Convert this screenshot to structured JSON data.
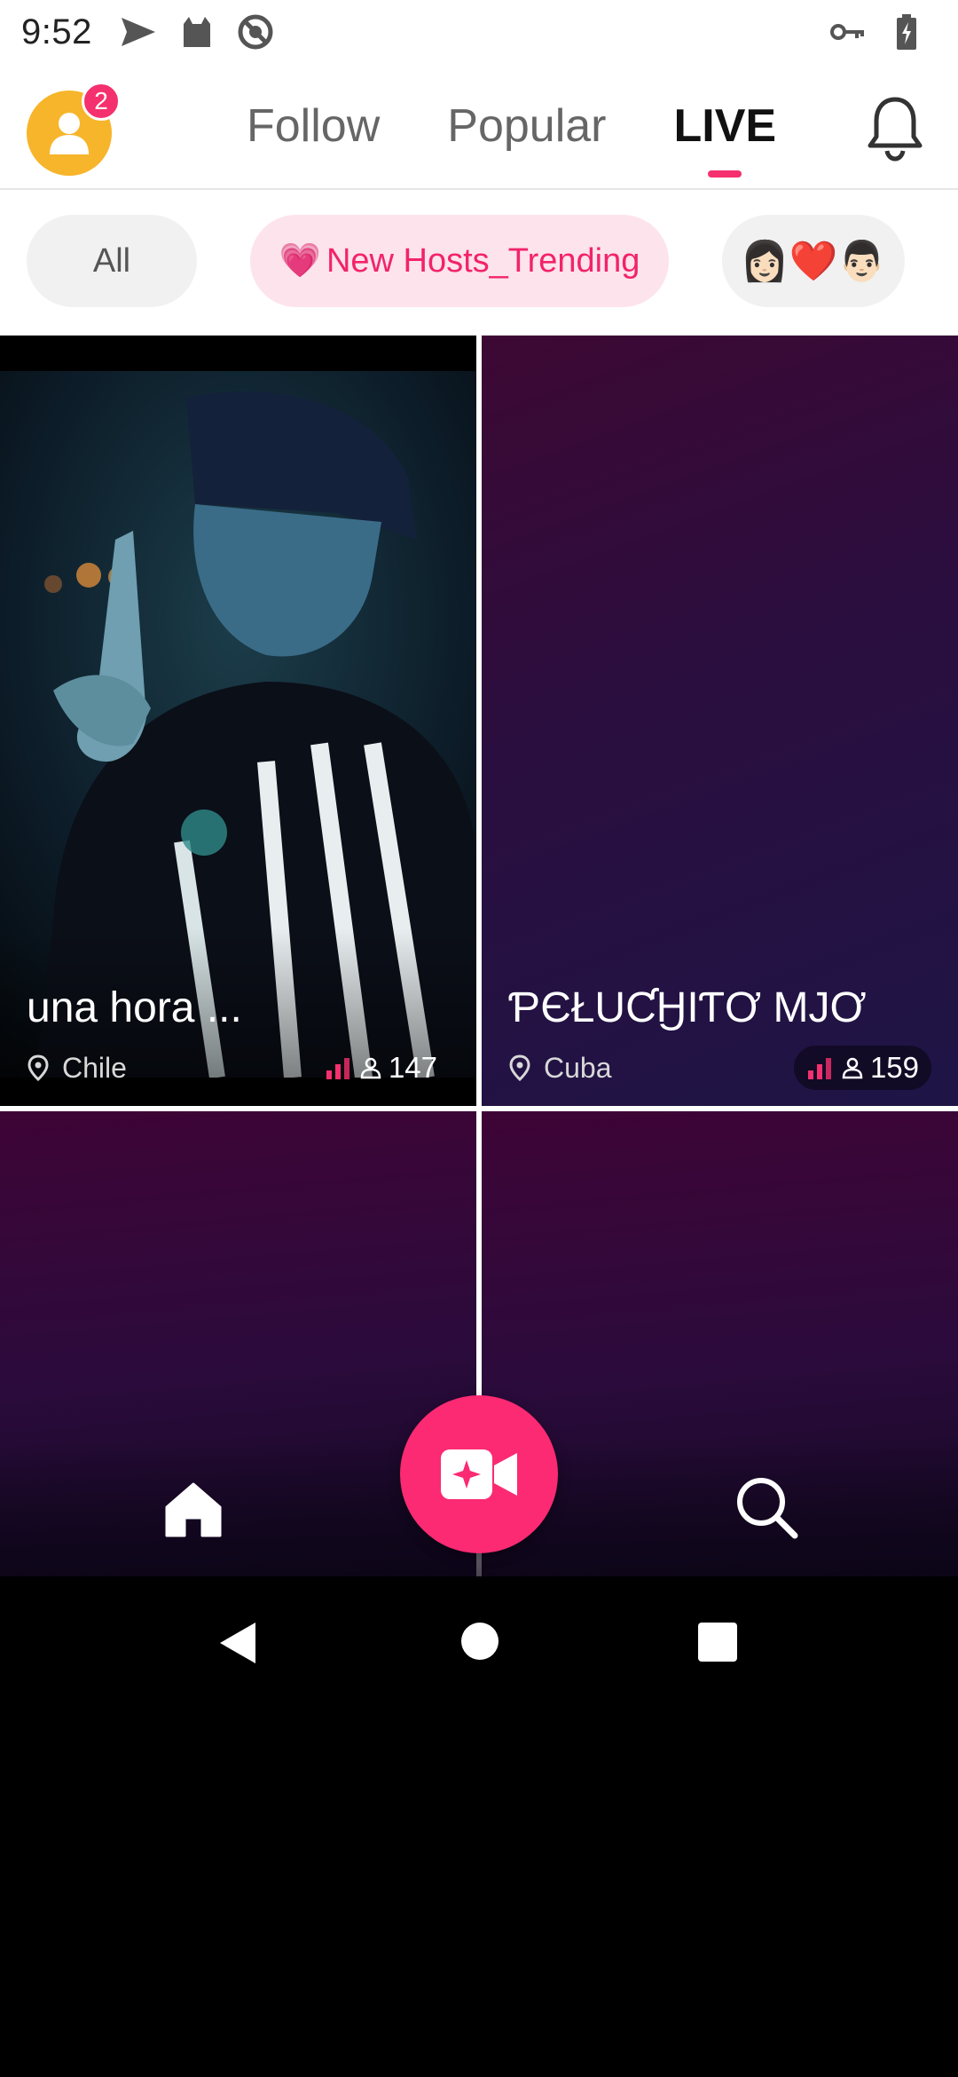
{
  "status_bar": {
    "time": "9:52",
    "icons_left": [
      "send-icon",
      "cat-icon",
      "no-ads-icon"
    ],
    "icons_right": [
      "key-icon",
      "battery-charging-icon"
    ]
  },
  "header": {
    "notification_count": "2",
    "tabs": [
      {
        "label": "Follow",
        "active": false
      },
      {
        "label": "Popular",
        "active": false
      },
      {
        "label": "LIVE",
        "active": true
      }
    ],
    "accent_color": "#f5306e"
  },
  "filters": {
    "all_label": "All",
    "trending_label": "New Hosts_Trending",
    "trending_icon": "💗",
    "couple_label": "👩🏻❤️👨🏻"
  },
  "streams": [
    {
      "title": "una hora ...",
      "location": "Chile",
      "viewers": "147"
    },
    {
      "title": "ƤЄŁUƇӇIƬƠ MJƠ",
      "location": "Cuba",
      "viewers": "159"
    }
  ],
  "bottom_nav": {
    "items": [
      "home-icon",
      "go-live-icon",
      "search-icon"
    ]
  }
}
